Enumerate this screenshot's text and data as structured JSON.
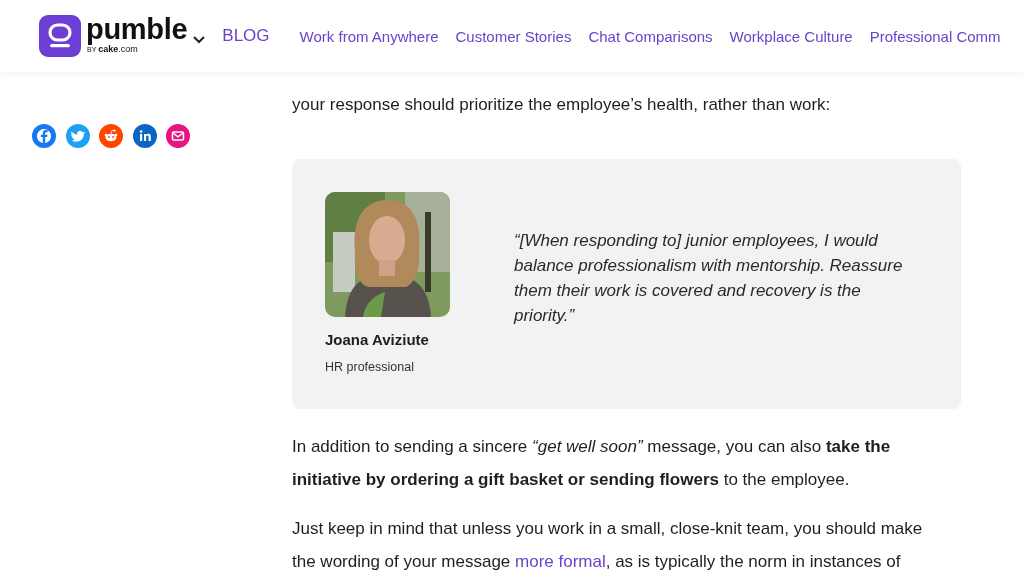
{
  "header": {
    "logo": {
      "wordmark": "pumble",
      "byline_prefix": "BY",
      "byline_brand": "cake",
      "byline_suffix": ".com"
    },
    "nav": [
      {
        "label": "BLOG",
        "kind": "home"
      },
      {
        "label": "Work from Anywhere",
        "kind": "link"
      },
      {
        "label": "Customer Stories",
        "kind": "link"
      },
      {
        "label": "Chat Comparisons",
        "kind": "link"
      },
      {
        "label": "Workplace Culture",
        "kind": "link"
      },
      {
        "label": "Professional Comm",
        "kind": "link"
      }
    ]
  },
  "share": [
    {
      "kind": "facebook",
      "color": "#1877f2"
    },
    {
      "kind": "twitter",
      "color": "#1da1f2"
    },
    {
      "kind": "reddit",
      "color": "#ff4500"
    },
    {
      "kind": "linkedin",
      "color": "#0a66c2"
    },
    {
      "kind": "email",
      "color": "#e8147f"
    }
  ],
  "article": [
    {
      "kind": "paragraph",
      "segments": [
        {
          "kind": "text",
          "text": "your response should prioritize the employee’s health, rather than work:"
        }
      ]
    },
    {
      "kind": "quote",
      "author": "Joana Aviziute",
      "role": "HR professional",
      "text": "“[When responding to] junior employees, I would balance professionalism with mentorship. Reassure them their work is covered and recovery is the priority.”"
    },
    {
      "kind": "paragraph",
      "segments": [
        {
          "kind": "text",
          "text": "In addition to sending a sincere *“get well soon”* message, you can also **take the initiative by ordering a gift basket or sending flowers** to the employee."
        }
      ]
    },
    {
      "kind": "paragraph",
      "segments": [
        {
          "kind": "text",
          "text": "Just keep in mind that unless you work in a small, close-knit team, you should make the wording of your message "
        },
        {
          "kind": "link",
          "text": "more formal"
        },
        {
          "kind": "text",
          "text": ", as is typically the norm in instances of"
        }
      ]
    }
  ]
}
